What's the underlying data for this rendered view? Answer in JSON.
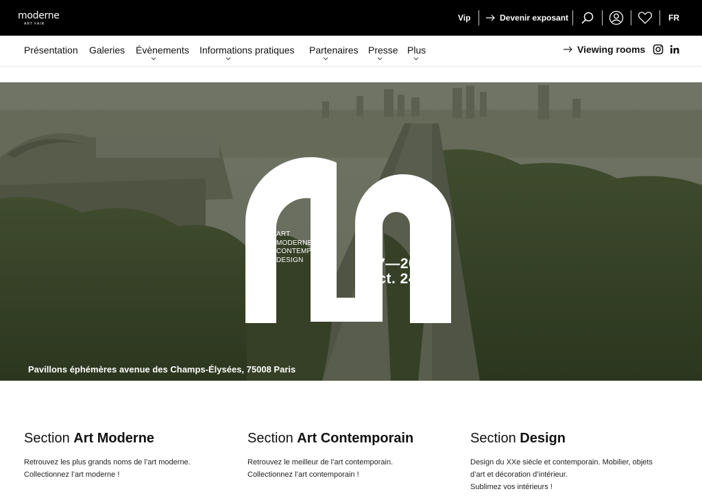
{
  "header": {
    "logo_main": "moderne",
    "logo_sub": "ART FAIR",
    "vip": "Vip",
    "devenir_exposant": "Devenir exposant",
    "lang": "FR",
    "icons": [
      "search-icon",
      "user-icon",
      "heart-icon"
    ]
  },
  "nav": {
    "items": [
      {
        "label": "Présentation",
        "has_caret": false
      },
      {
        "label": "Galeries",
        "has_caret": false
      },
      {
        "label": "Évènements",
        "has_caret": true
      },
      {
        "label": "Informations pratiques",
        "has_caret": true
      },
      {
        "label": "Partenaires",
        "has_caret": true
      },
      {
        "label": "Presse",
        "has_caret": true
      },
      {
        "label": "Plus",
        "has_caret": true
      }
    ],
    "viewing_rooms": "Viewing rooms",
    "social": [
      "instagram-icon",
      "linkedin-icon"
    ]
  },
  "hero": {
    "tagline_lines": [
      "ART",
      "MODERNE &",
      "CONTEMPORAIN,",
      "DESIGN"
    ],
    "date_line1": "17—20",
    "date_line2": "oct. 24",
    "address": "Pavillons éphémères avenue des Champs-Élysées, 75008 Paris"
  },
  "sections": [
    {
      "prefix": "Section ",
      "title": "Art Moderne",
      "lines": [
        "Retrouvez les plus grands noms de l’art moderne.",
        "Collectionnez l’art moderne !"
      ]
    },
    {
      "prefix": "Section ",
      "title": "Art Contemporain",
      "lines": [
        "Retrouvez le meilleur de l’art contemporain.",
        "Collectionnez l’art contemporain !"
      ]
    },
    {
      "prefix": "Section ",
      "title": "Design",
      "lines": [
        "Design du XXe siècle et contemporain. Mobilier, objets",
        "d’art et décoration d’intérieur.",
        "Sublimez vos intérieurs !"
      ]
    }
  ]
}
